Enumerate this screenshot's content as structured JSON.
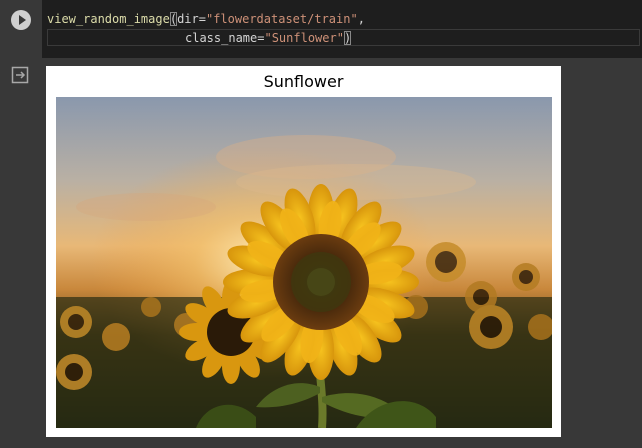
{
  "cell": {
    "code_line1_fn": "view_random_image",
    "code_line1_open": "(",
    "code_line1_arg": "dir=",
    "code_line1_str": "\"flowerdataset/train\"",
    "code_line1_comma": ",",
    "code_line2_arg": "class_name=",
    "code_line2_str": "\"Sunflower\"",
    "code_line2_close": ")"
  },
  "output": {
    "figure_title": "Sunflower"
  },
  "icons": {
    "run": "play-circle-icon",
    "output": "output-clear-icon"
  },
  "colors": {
    "background": "#383838",
    "editor": "#1e1e1e",
    "string": "#ce9178",
    "function": "#dcdcaa"
  }
}
